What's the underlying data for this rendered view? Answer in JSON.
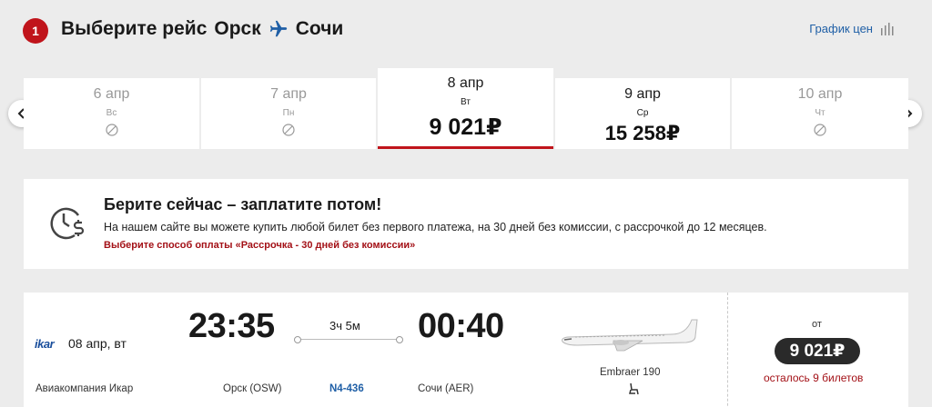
{
  "header": {
    "step": "1",
    "title_prefix": "Выберите рейс",
    "origin": "Орск",
    "destination": "Сочи",
    "price_chart_label": "График цен"
  },
  "dates": [
    {
      "date": "6 апр",
      "weekday": "Вс",
      "price": null,
      "available": false,
      "active": false
    },
    {
      "date": "7 апр",
      "weekday": "Пн",
      "price": null,
      "available": false,
      "active": false
    },
    {
      "date": "8 апр",
      "weekday": "Вт",
      "price": "9 021₽",
      "available": true,
      "active": true
    },
    {
      "date": "9 апр",
      "weekday": "Ср",
      "price": "15 258₽",
      "available": true,
      "active": false
    },
    {
      "date": "10 апр",
      "weekday": "Чт",
      "price": null,
      "available": false,
      "active": false
    }
  ],
  "promo": {
    "title": "Берите сейчас – заплатите потом!",
    "text": "На нашем сайте вы можете купить любой билет без первого платежа, на 30 дней без комиссии, с рассрочкой до 12 месяцев.",
    "link": "Выберите способ оплаты «Рассрочка - 30 дней без комиссии»"
  },
  "flight": {
    "airline_logo": "ikar",
    "date": "08 апр, вт",
    "airline": "Авиакомпания Икар",
    "departure_time": "23:35",
    "arrival_time": "00:40",
    "duration": "3ч 5м",
    "departure_airport": "Орск (OSW)",
    "arrival_airport": "Сочи (AER)",
    "flight_number": "N4-436",
    "aircraft": "Embraer 190",
    "price_prefix": "от",
    "price": "9 021₽",
    "seats_left": "осталось 9 билетов"
  },
  "colors": {
    "accent": "#c0141b",
    "link": "#1f5fa6",
    "background": "#ececec"
  }
}
